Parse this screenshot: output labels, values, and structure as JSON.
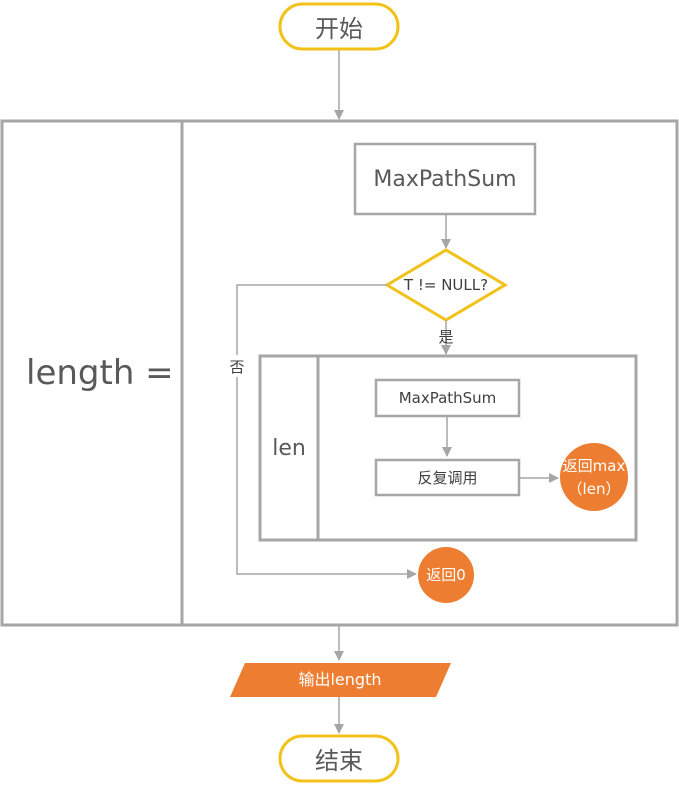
{
  "nodes": {
    "start": "开始",
    "end": "结束",
    "length_assign": "length =",
    "len_label": "len",
    "max_path_sum_outer": "MaxPathSum",
    "condition": "T != NULL?",
    "yes_label": "是",
    "no_label": "否",
    "max_path_sum_inner": "MaxPathSum",
    "recursive_call": "反复调用",
    "return_max_line1": "返回max",
    "return_max_line2": "（len）",
    "return_zero": "返回0",
    "output": "输出length"
  },
  "colors": {
    "terminal_border": "#f2c218",
    "decision_border": "#f2c218",
    "box_border": "#a6a6a6",
    "arrow": "#a6a6a6",
    "accent_orange": "#ed7d31"
  }
}
